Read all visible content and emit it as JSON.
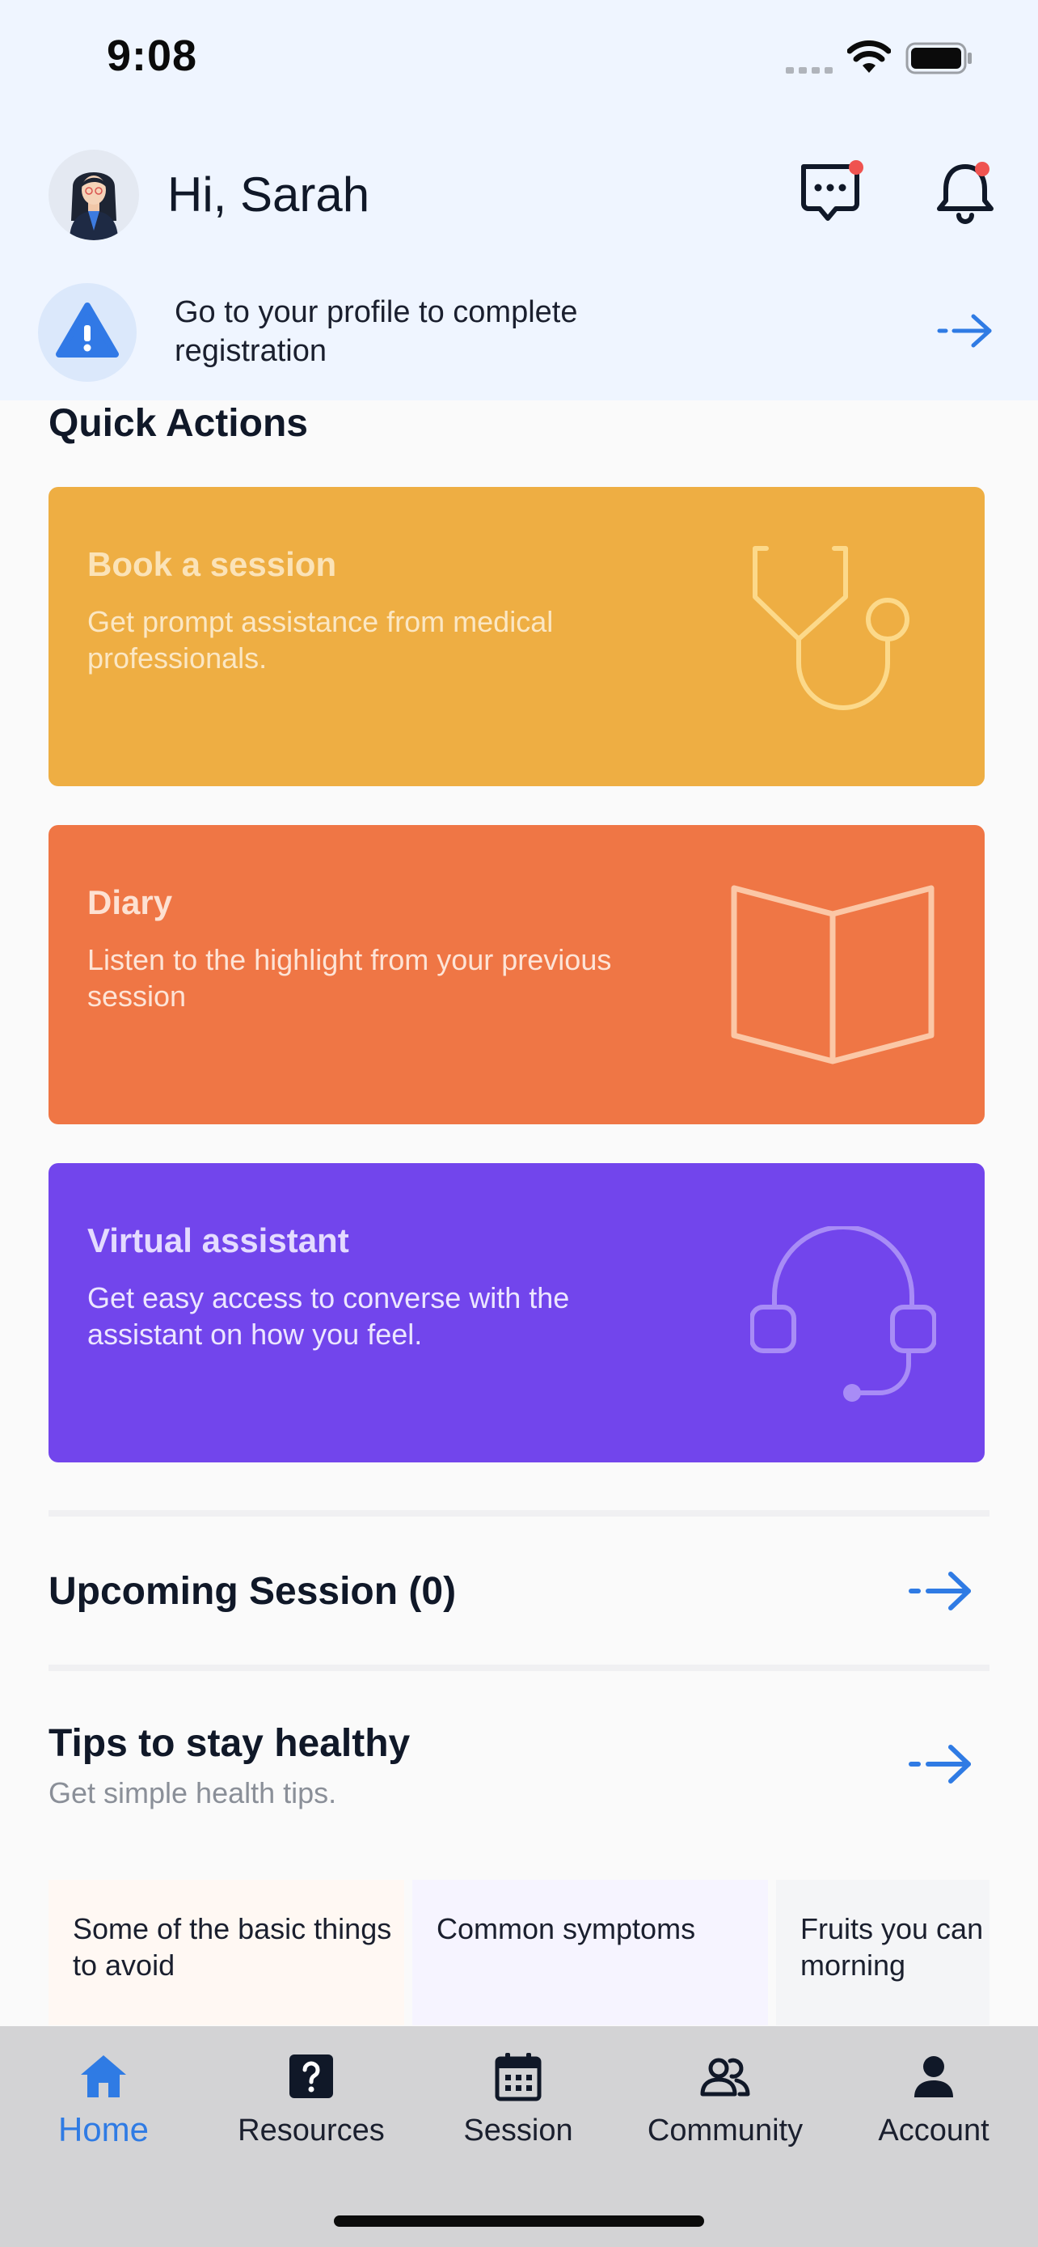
{
  "status_bar": {
    "time": "9:08"
  },
  "header": {
    "greeting": "Hi, Sarah"
  },
  "alert": {
    "text": "Go to your profile to complete registration"
  },
  "quick_actions": {
    "title": "Quick Actions",
    "cards": [
      {
        "title": "Book a session",
        "desc": "Get prompt assistance from medical professionals.",
        "color": "#eeae43",
        "icon": "stethoscope-icon"
      },
      {
        "title": "Diary",
        "desc": "Listen to the highlight from your previous session",
        "color": "#ef7645",
        "icon": "open-book-icon"
      },
      {
        "title": "Virtual assistant",
        "desc": "Get easy access to converse with the assistant on how you feel.",
        "color": "#7245ec",
        "icon": "headset-icon"
      }
    ]
  },
  "upcoming": {
    "title": "Upcoming Session (0)"
  },
  "tips": {
    "title": "Tips to stay healthy",
    "subtitle": "Get simple health tips.",
    "items": [
      {
        "text": "Some of the basic things to avoid"
      },
      {
        "text": "Common symptoms"
      },
      {
        "text": "Fruits you can in the morning"
      }
    ]
  },
  "nav": {
    "items": [
      {
        "label": "Home",
        "icon": "home-icon",
        "active": true
      },
      {
        "label": "Resources",
        "icon": "question-icon"
      },
      {
        "label": "Session",
        "icon": "calendar-icon"
      },
      {
        "label": "Community",
        "icon": "people-icon"
      },
      {
        "label": "Account",
        "icon": "person-icon"
      }
    ]
  },
  "colors": {
    "accent": "#2f7be4",
    "notification_dot": "#ef5350"
  }
}
